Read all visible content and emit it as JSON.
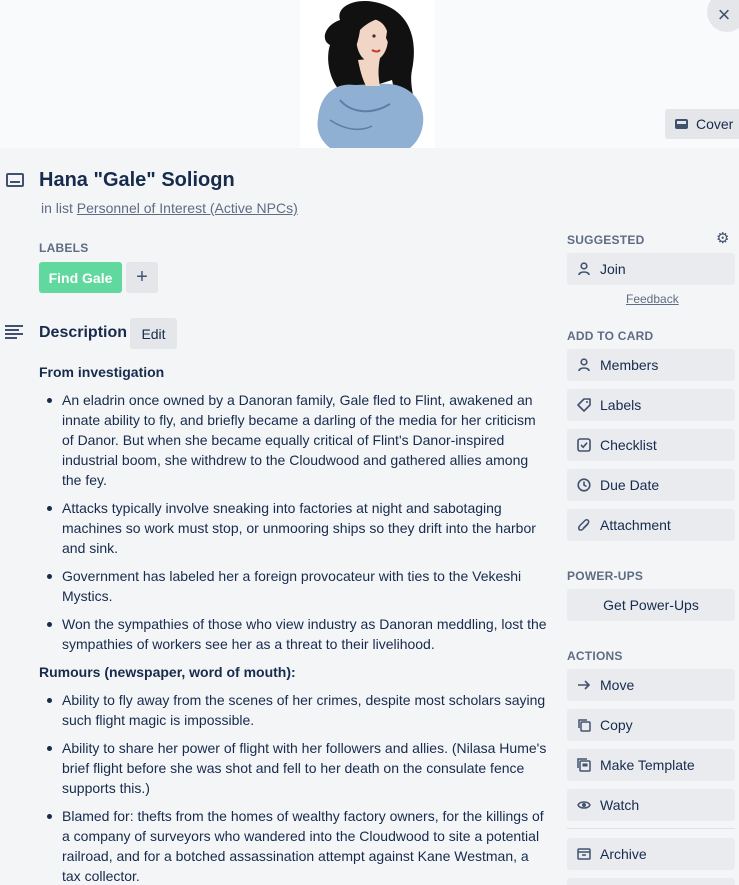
{
  "card": {
    "title": "Hana \"Gale\" Soliogn",
    "in_list_prefix": "in list",
    "list_name": "Personnel of Interest (Active NPCs)"
  },
  "cover": {
    "button_label": "Cover"
  },
  "labels": {
    "heading": "LABELS",
    "items": [
      "Find Gale"
    ],
    "label_color": "#61d89e"
  },
  "description": {
    "heading": "Description",
    "edit_label": "Edit",
    "section1_title": "From investigation",
    "section1_items": [
      "An eladrin once owned by a Danoran family, Gale fled to Flint, awakened an innate ability to fly, and briefly became a darling of the media for her criticism of Danor. But when she became equally critical of Flint's Danor-inspired industrial boom, she withdrew to the Cloudwood and gathered allies among the fey.",
      "Attacks typically involve sneaking into factories at night and sabotaging machines so work must stop, or unmooring ships so they drift into the harbor and sink.",
      "Government has labeled her a foreign provocateur with ties to the Vekeshi Mystics.",
      "Won the sympathies of those who view industry as Danoran meddling, lost the sympathies of workers see her as a threat to their livelihood."
    ],
    "section2_title": "Rumours (newspaper, word of mouth):",
    "section2_items": [
      "Ability to fly away from the scenes of her crimes, despite most scholars saying such flight magic is impossible.",
      "Ability to share her power of flight with her followers and allies. (Nilasa Hume's brief flight before she was shot and fell to her death on the consulate fence supports this.)",
      "Blamed for: thefts from the homes of wealthy factory owners, for the killings of a company of surveyors who wandered into the Cloudwood to site a potential railroad, and for a botched assassination attempt against Kane Westman, a tax collector."
    ]
  },
  "sidebar": {
    "suggested_heading": "SUGGESTED",
    "join_label": "Join",
    "feedback_label": "Feedback",
    "add_heading": "ADD TO CARD",
    "add_items": [
      "Members",
      "Labels",
      "Checklist",
      "Due Date",
      "Attachment"
    ],
    "powerups_heading": "POWER-UPS",
    "get_powerups_label": "Get Power-Ups",
    "actions_heading": "ACTIONS",
    "action_items": [
      "Move",
      "Copy",
      "Make Template",
      "Watch"
    ],
    "archive_label": "Archive"
  },
  "icons": {
    "close": "close-icon",
    "card": "card-icon",
    "description": "description-icon",
    "gear": "gear-icon"
  },
  "colors": {
    "background": "#f4f5f7",
    "button": "#e9ebef",
    "text": "#172b4d",
    "muted": "#5e6c84"
  }
}
